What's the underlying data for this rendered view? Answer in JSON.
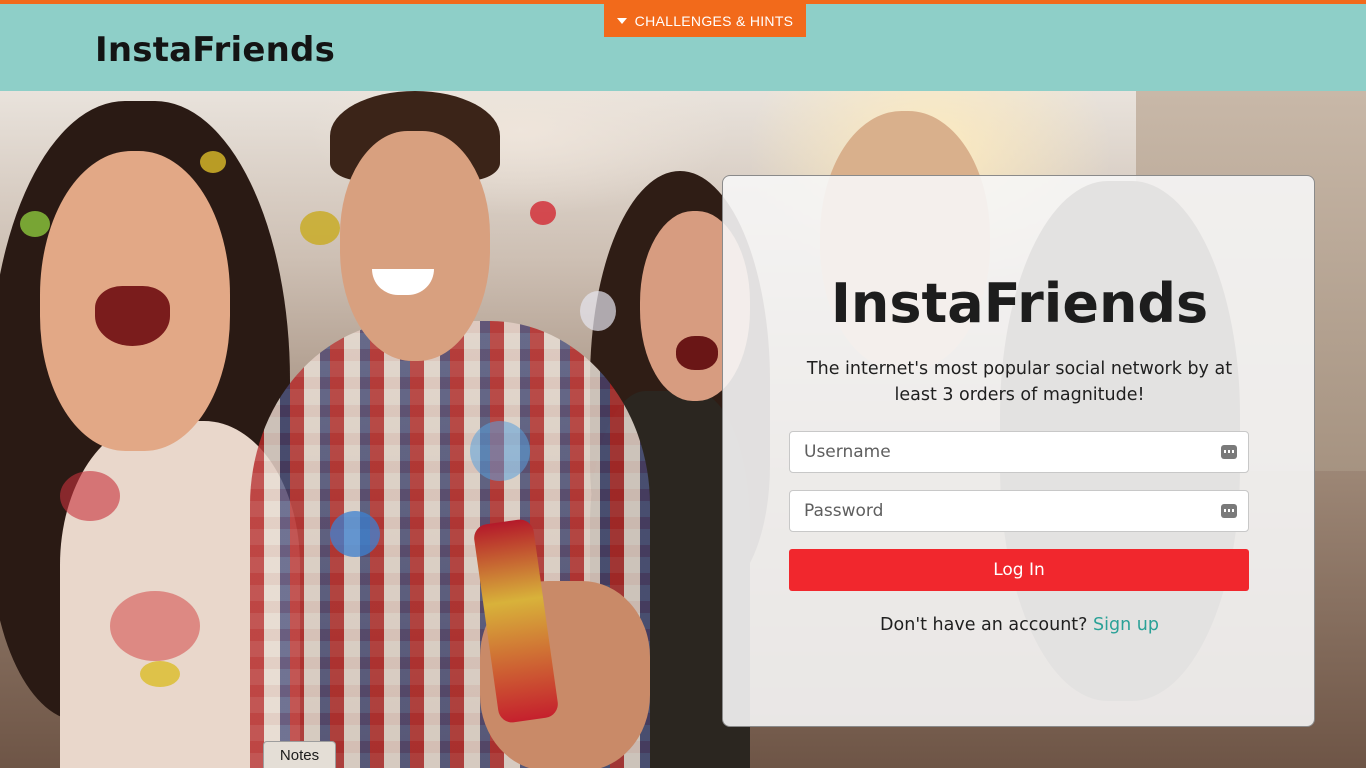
{
  "header": {
    "brand": "InstaFriends",
    "challenges_label": "CHALLENGES & HINTS"
  },
  "login": {
    "title": "InstaFriends",
    "tagline": "The internet's most popular social network by at least 3 orders of magnitude!",
    "username_placeholder": "Username",
    "password_placeholder": "Password",
    "login_button": "Log In",
    "signup_prompt": "Don't have an account?",
    "signup_link": "Sign up"
  },
  "notes": {
    "label": "Notes"
  },
  "colors": {
    "header_bg": "#8ecfc8",
    "accent_orange": "#f26a1b",
    "login_red": "#f1272d",
    "link_teal": "#2aa197"
  },
  "icons": {
    "challenges": "caret-down-icon",
    "field_autofill": "password-manager-key-icon"
  }
}
